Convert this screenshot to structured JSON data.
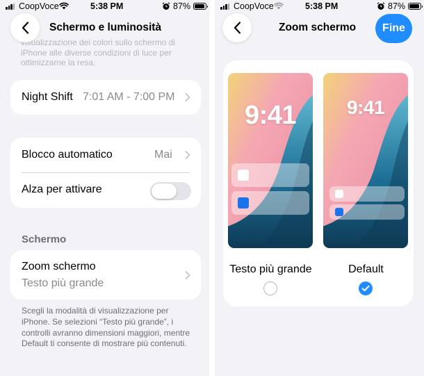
{
  "left": {
    "status": {
      "carrier": "CoopVoce",
      "time": "5:38 PM",
      "battery": "87%"
    },
    "nav": {
      "title": "Schermo e luminosità"
    },
    "faded_text": "visualizzazione dei colori sullo schermo di iPhone alle diverse condizioni di luce per ottimizzarne la resa.",
    "night_shift": {
      "label": "Night Shift",
      "value": "7:01 AM - 7:00 PM"
    },
    "auto_lock": {
      "label": "Blocco automatico",
      "value": "Mai"
    },
    "raise_to_wake": {
      "label": "Alza per attivare",
      "enabled": false
    },
    "section_header": "Schermo",
    "display_zoom": {
      "label": "Zoom schermo",
      "value": "Testo più grande"
    },
    "footnote": "Scegli la modalità di visualizzazione per iPhone. Se selezioni “Testo più grande”, i controlli avranno dimensioni maggiori, mentre Default ti consente di mostrare più contenuti."
  },
  "right": {
    "status": {
      "carrier": "CoopVoce",
      "time": "5:38 PM",
      "battery": "87%"
    },
    "nav": {
      "title": "Zoom schermo",
      "done_label": "Fine"
    },
    "options": [
      {
        "label": "Testo più grande",
        "clock": "9:41",
        "selected": false
      },
      {
        "label": "Default",
        "clock": "9:41",
        "selected": true
      }
    ]
  },
  "icons": {
    "back": "chevron-left-icon",
    "disclosure": "chevron-right-icon",
    "wifi": "wifi-icon",
    "alarm": "alarm-icon",
    "battery": "battery-icon",
    "signal": "signal-icon",
    "check": "checkmark-icon"
  },
  "colors": {
    "accent": "#1f8dff",
    "background": "#f2f2f7",
    "card": "#ffffff",
    "secondary_text": "#8a8a8e",
    "wallpaper_pink": "#f4a7b2",
    "wallpaper_teal": "#1e6f96",
    "notif_icon_blue": "#1a73e8"
  }
}
